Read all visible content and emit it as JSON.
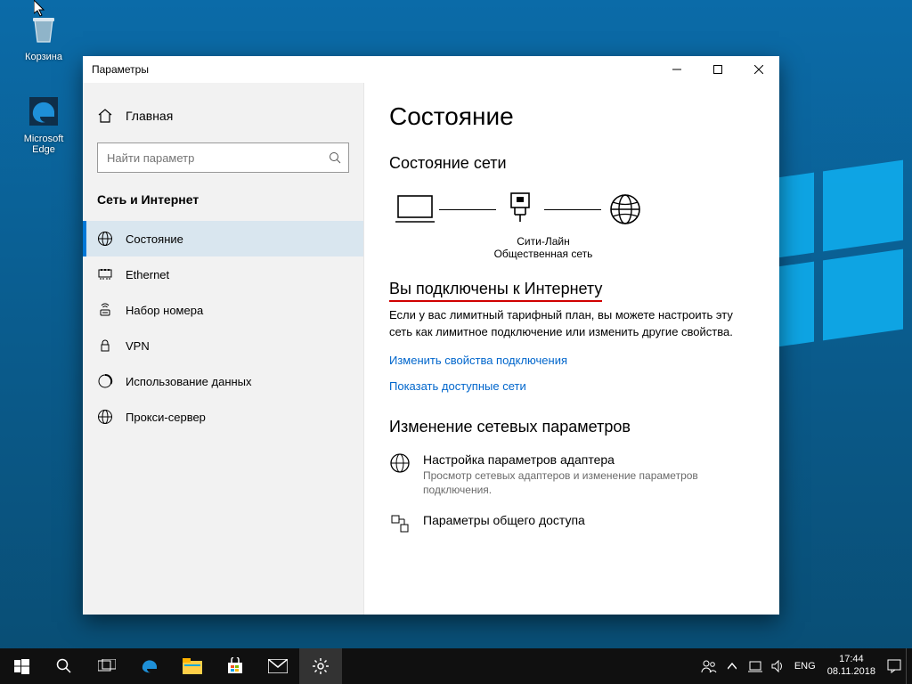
{
  "desktop": {
    "icons": [
      {
        "label": "Корзина"
      },
      {
        "label": "Microsoft Edge"
      }
    ]
  },
  "window": {
    "title": "Параметры",
    "home": "Главная",
    "search_placeholder": "Найти параметр",
    "group_title": "Сеть и Интернет",
    "nav": [
      {
        "label": "Состояние"
      },
      {
        "label": "Ethernet"
      },
      {
        "label": "Набор номера"
      },
      {
        "label": "VPN"
      },
      {
        "label": "Использование данных"
      },
      {
        "label": "Прокси-сервер"
      }
    ]
  },
  "content": {
    "page_title": "Состояние",
    "net_status_heading": "Состояние сети",
    "diagram": {
      "network_name": "Сити-Лайн",
      "network_type": "Общественная сеть"
    },
    "connected_heading": "Вы подключены к Интернету",
    "connected_body": "Если у вас лимитный тарифный план, вы можете настроить эту сеть как лимитное подключение или изменить другие свойства.",
    "link_change_props": "Изменить свойства подключения",
    "link_show_networks": "Показать доступные сети",
    "change_params_heading": "Изменение сетевых параметров",
    "options": [
      {
        "title": "Настройка параметров адаптера",
        "desc": "Просмотр сетевых адаптеров и изменение параметров подключения."
      },
      {
        "title": "Параметры общего доступа",
        "desc": ""
      }
    ]
  },
  "taskbar": {
    "lang": "ENG",
    "time": "17:44",
    "date": "08.11.2018"
  }
}
